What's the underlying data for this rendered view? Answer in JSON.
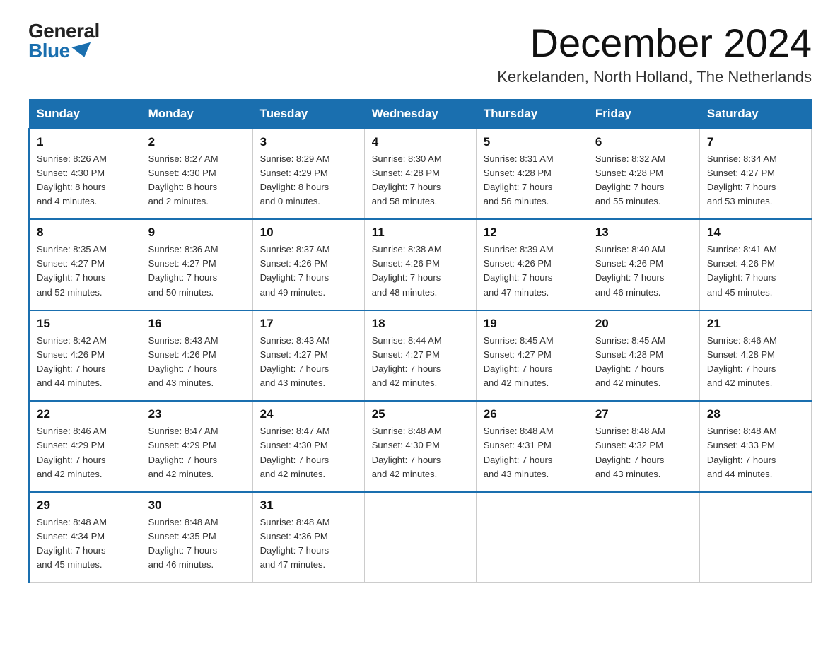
{
  "logo": {
    "general": "General",
    "blue": "Blue"
  },
  "title": "December 2024",
  "subtitle": "Kerkelanden, North Holland, The Netherlands",
  "days_of_week": [
    "Sunday",
    "Monday",
    "Tuesday",
    "Wednesday",
    "Thursday",
    "Friday",
    "Saturday"
  ],
  "weeks": [
    [
      {
        "day": "1",
        "sunrise": "8:26 AM",
        "sunset": "4:30 PM",
        "daylight": "8 hours and 4 minutes."
      },
      {
        "day": "2",
        "sunrise": "8:27 AM",
        "sunset": "4:30 PM",
        "daylight": "8 hours and 2 minutes."
      },
      {
        "day": "3",
        "sunrise": "8:29 AM",
        "sunset": "4:29 PM",
        "daylight": "8 hours and 0 minutes."
      },
      {
        "day": "4",
        "sunrise": "8:30 AM",
        "sunset": "4:28 PM",
        "daylight": "7 hours and 58 minutes."
      },
      {
        "day": "5",
        "sunrise": "8:31 AM",
        "sunset": "4:28 PM",
        "daylight": "7 hours and 56 minutes."
      },
      {
        "day": "6",
        "sunrise": "8:32 AM",
        "sunset": "4:28 PM",
        "daylight": "7 hours and 55 minutes."
      },
      {
        "day": "7",
        "sunrise": "8:34 AM",
        "sunset": "4:27 PM",
        "daylight": "7 hours and 53 minutes."
      }
    ],
    [
      {
        "day": "8",
        "sunrise": "8:35 AM",
        "sunset": "4:27 PM",
        "daylight": "7 hours and 52 minutes."
      },
      {
        "day": "9",
        "sunrise": "8:36 AM",
        "sunset": "4:27 PM",
        "daylight": "7 hours and 50 minutes."
      },
      {
        "day": "10",
        "sunrise": "8:37 AM",
        "sunset": "4:26 PM",
        "daylight": "7 hours and 49 minutes."
      },
      {
        "day": "11",
        "sunrise": "8:38 AM",
        "sunset": "4:26 PM",
        "daylight": "7 hours and 48 minutes."
      },
      {
        "day": "12",
        "sunrise": "8:39 AM",
        "sunset": "4:26 PM",
        "daylight": "7 hours and 47 minutes."
      },
      {
        "day": "13",
        "sunrise": "8:40 AM",
        "sunset": "4:26 PM",
        "daylight": "7 hours and 46 minutes."
      },
      {
        "day": "14",
        "sunrise": "8:41 AM",
        "sunset": "4:26 PM",
        "daylight": "7 hours and 45 minutes."
      }
    ],
    [
      {
        "day": "15",
        "sunrise": "8:42 AM",
        "sunset": "4:26 PM",
        "daylight": "7 hours and 44 minutes."
      },
      {
        "day": "16",
        "sunrise": "8:43 AM",
        "sunset": "4:26 PM",
        "daylight": "7 hours and 43 minutes."
      },
      {
        "day": "17",
        "sunrise": "8:43 AM",
        "sunset": "4:27 PM",
        "daylight": "7 hours and 43 minutes."
      },
      {
        "day": "18",
        "sunrise": "8:44 AM",
        "sunset": "4:27 PM",
        "daylight": "7 hours and 42 minutes."
      },
      {
        "day": "19",
        "sunrise": "8:45 AM",
        "sunset": "4:27 PM",
        "daylight": "7 hours and 42 minutes."
      },
      {
        "day": "20",
        "sunrise": "8:45 AM",
        "sunset": "4:28 PM",
        "daylight": "7 hours and 42 minutes."
      },
      {
        "day": "21",
        "sunrise": "8:46 AM",
        "sunset": "4:28 PM",
        "daylight": "7 hours and 42 minutes."
      }
    ],
    [
      {
        "day": "22",
        "sunrise": "8:46 AM",
        "sunset": "4:29 PM",
        "daylight": "7 hours and 42 minutes."
      },
      {
        "day": "23",
        "sunrise": "8:47 AM",
        "sunset": "4:29 PM",
        "daylight": "7 hours and 42 minutes."
      },
      {
        "day": "24",
        "sunrise": "8:47 AM",
        "sunset": "4:30 PM",
        "daylight": "7 hours and 42 minutes."
      },
      {
        "day": "25",
        "sunrise": "8:48 AM",
        "sunset": "4:30 PM",
        "daylight": "7 hours and 42 minutes."
      },
      {
        "day": "26",
        "sunrise": "8:48 AM",
        "sunset": "4:31 PM",
        "daylight": "7 hours and 43 minutes."
      },
      {
        "day": "27",
        "sunrise": "8:48 AM",
        "sunset": "4:32 PM",
        "daylight": "7 hours and 43 minutes."
      },
      {
        "day": "28",
        "sunrise": "8:48 AM",
        "sunset": "4:33 PM",
        "daylight": "7 hours and 44 minutes."
      }
    ],
    [
      {
        "day": "29",
        "sunrise": "8:48 AM",
        "sunset": "4:34 PM",
        "daylight": "7 hours and 45 minutes."
      },
      {
        "day": "30",
        "sunrise": "8:48 AM",
        "sunset": "4:35 PM",
        "daylight": "7 hours and 46 minutes."
      },
      {
        "day": "31",
        "sunrise": "8:48 AM",
        "sunset": "4:36 PM",
        "daylight": "7 hours and 47 minutes."
      },
      null,
      null,
      null,
      null
    ]
  ],
  "labels": {
    "sunrise": "Sunrise:",
    "sunset": "Sunset:",
    "daylight": "Daylight:"
  }
}
